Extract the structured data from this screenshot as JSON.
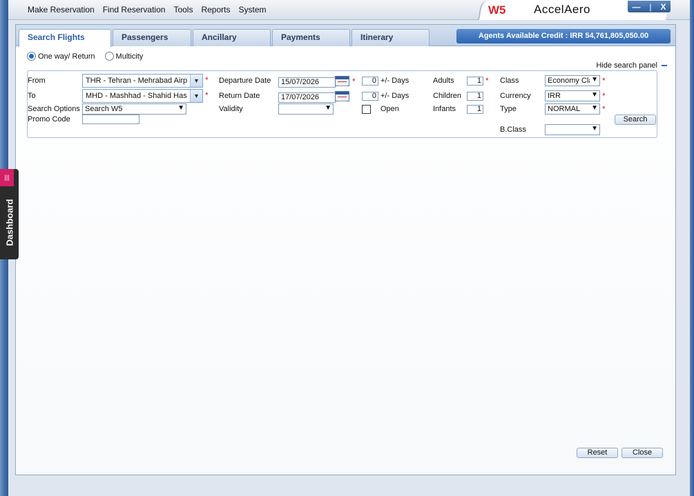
{
  "menu": [
    "Make Reservation",
    "Find Reservation",
    "Tools",
    "Reports",
    "System"
  ],
  "brand": {
    "code": "W5",
    "name": "AccelAero"
  },
  "window_controls": {
    "minimize": "—",
    "restore": "|",
    "close": "X"
  },
  "tabs": [
    "Search Flights",
    "Passengers",
    "Ancillary",
    "Payments",
    "Itinerary"
  ],
  "credit": "Agents Available Credit : IRR 54,761,805,050.00",
  "trip_type": {
    "option1": "One way/ Return",
    "option2": "Multicity",
    "selected": "One way/ Return"
  },
  "hide_panel": "Hide search panel",
  "form": {
    "from_label": "From",
    "from_value": "THR - Tehran - Mehrabad Airport",
    "to_label": "To",
    "to_value": "MHD - Mashhad - Shahid Hashemi",
    "search_options_label": "Search Options",
    "search_options_value": "Search W5",
    "promo_label": "Promo Code",
    "promo_value": "",
    "departure_label": "Departure Date",
    "departure_value": "15/07/2026",
    "return_label": "Return Date",
    "return_value": "17/07/2026",
    "validity_label": "Validity",
    "validity_value": "",
    "dep_days": "0",
    "ret_days": "0",
    "days_label": "+/- Days",
    "open_label": "Open",
    "adults_label": "Adults",
    "adults": "1",
    "children_label": "Children",
    "children": "1",
    "infants_label": "Infants",
    "infants": "1",
    "class_label": "Class",
    "class_value": "Economy Class",
    "currency_label": "Currency",
    "currency_value": "IRR",
    "type_label": "Type",
    "type_value": "NORMAL",
    "bclass_label": "B.Class",
    "bclass_value": "",
    "required_mark": "*"
  },
  "buttons": {
    "search": "Search",
    "reset": "Reset",
    "close": "Close"
  },
  "dashboard": {
    "label": "Dashboard",
    "icon": "|||"
  }
}
